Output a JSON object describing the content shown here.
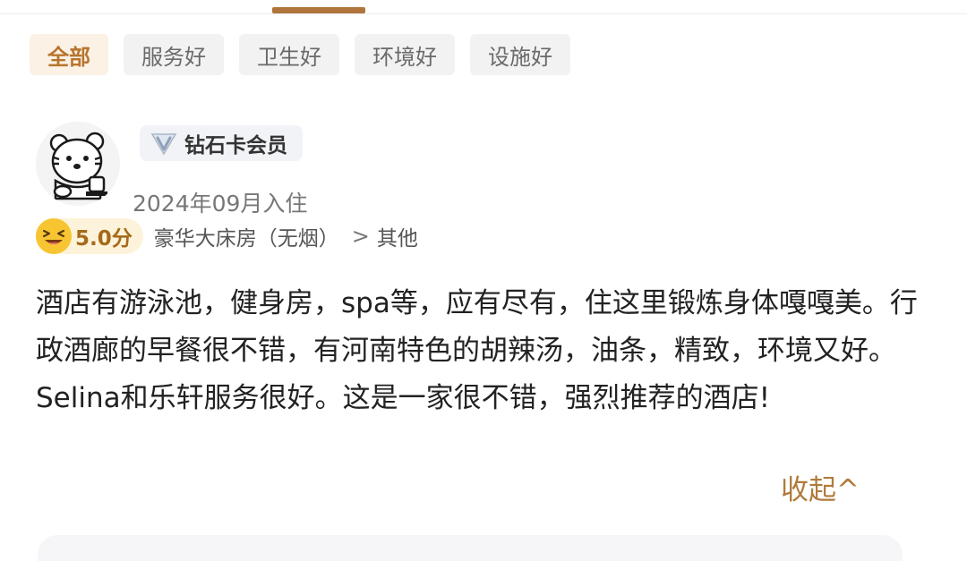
{
  "filters": {
    "all": "全部",
    "service": "服务好",
    "hygiene": "卫生好",
    "environment": "环境好",
    "facilities": "设施好"
  },
  "review": {
    "member_badge": "钻石卡会员",
    "checkin": "2024年09月入住",
    "score": "5.0分",
    "room_type": "豪华大床房（无烟）",
    "trip_type": "其他",
    "text": "酒店有游泳池，健身房，spa等，应有尽有，住这里锻炼身体嘎嘎美。行政酒廊的早餐很不错，有河南特色的胡辣汤，油条，精致，环境又好。Selina和乐轩服务很好。这是一家很不错，强烈推荐的酒店!",
    "collapse_label": "收起^"
  },
  "icons": {
    "avatar": "bear-cartoon-avatar",
    "badge": "diamond-v-icon",
    "score_emoji": "laughing-emoji-icon",
    "chevron": "chevron-right-icon"
  },
  "colors": {
    "accent": "#b07a3a",
    "active_chip_bg": "#fbf1e4",
    "chip_bg": "#f2f2f2",
    "emoji_yellow": "#f7c531"
  }
}
